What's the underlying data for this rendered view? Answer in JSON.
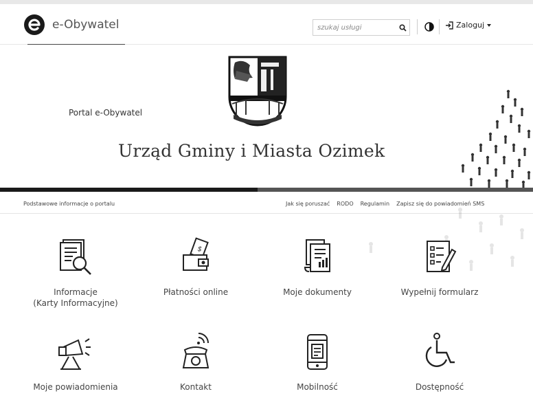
{
  "header": {
    "logo_text": "e-Obywatel",
    "search_placeholder": "szukaj usługi",
    "login_label": "Zaloguj",
    "icons": [
      "logo-e-icon",
      "search-icon",
      "contrast-icon",
      "login-icon",
      "caret-down-icon"
    ]
  },
  "hero": {
    "portal_label": "Portal e-Obywatel",
    "title": "Urząd Gminy i Miasta Ozimek"
  },
  "subnav": {
    "left_link": "Podstawowe informacje o portalu",
    "links": [
      "Jak się poruszać",
      "RODO",
      "Regulamin",
      "Zapisz się do powiadomień SMS"
    ]
  },
  "tiles": [
    {
      "line1": "Informacje",
      "line2": "(Karty Informacyjne)",
      "icon": "document-search-icon"
    },
    {
      "line1": "Płatności online",
      "line2": "",
      "icon": "payment-wallet-icon"
    },
    {
      "line1": "Moje dokumenty",
      "line2": "",
      "icon": "documents-scroll-icon"
    },
    {
      "line1": "Wypełnij formularz",
      "line2": "",
      "icon": "form-pencil-icon"
    },
    {
      "line1": "Moje powiadomienia",
      "line2": "",
      "icon": "megaphone-icon"
    },
    {
      "line1": "Kontakt",
      "line2": "",
      "icon": "telephone-icon"
    },
    {
      "line1": "Mobilność",
      "line2": "",
      "icon": "mobile-phone-icon"
    },
    {
      "line1": "Dostępność",
      "line2": "",
      "icon": "wheelchair-icon"
    }
  ]
}
